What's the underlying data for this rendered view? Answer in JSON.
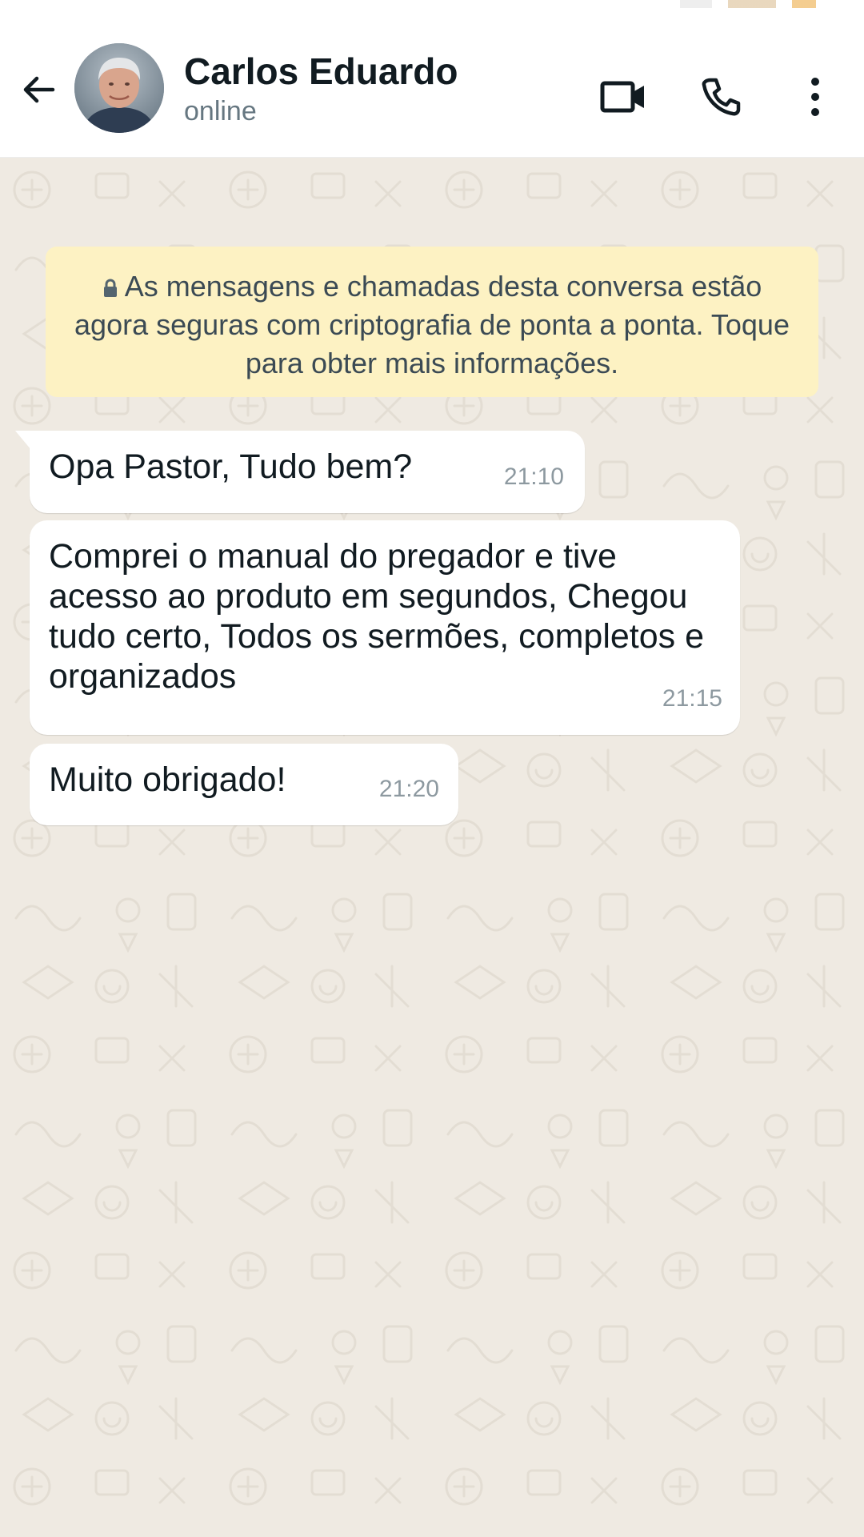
{
  "colors": {
    "header_bg": "#ffffff",
    "chat_bg": "#efeae2",
    "notice_bg": "#fdf2c3",
    "bubble_bg": "#ffffff",
    "text_primary": "#111b21",
    "text_secondary": "#667781"
  },
  "header": {
    "back_icon": "arrow-left-icon",
    "contact_name": "Carlos Eduardo",
    "contact_status": "online",
    "actions": [
      {
        "icon": "video-camera-icon"
      },
      {
        "icon": "phone-icon"
      },
      {
        "icon": "more-vertical-icon"
      }
    ]
  },
  "encryption_notice": {
    "icon": "lock-icon",
    "text": "As mensagens e chamadas desta conversa estão agora seguras com criptografia de ponta a ponta. Toque para obter mais informações."
  },
  "messages": [
    {
      "text": "Opa Pastor, Tudo bem?",
      "time": "21:10"
    },
    {
      "text": "Comprei o manual do pregador e tive acesso ao produto em segundos, Chegou tudo certo, Todos os sermões, completos e organizados",
      "time": "21:15"
    },
    {
      "text": "Muito obrigado!",
      "time": "21:20"
    }
  ]
}
